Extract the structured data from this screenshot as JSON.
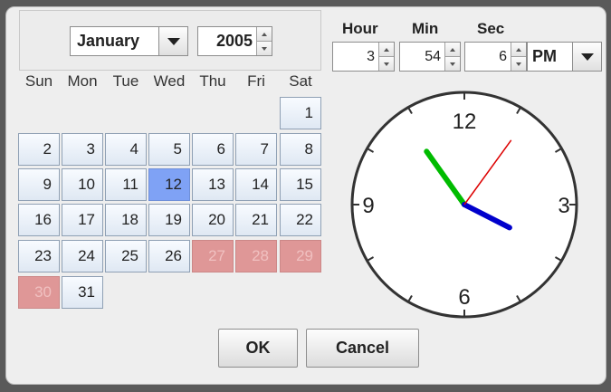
{
  "date": {
    "month": "January",
    "year": "2005",
    "weekdays": [
      "Sun",
      "Mon",
      "Tue",
      "Wed",
      "Thu",
      "Fri",
      "Sat"
    ],
    "selected_day": "12",
    "days": [
      "1",
      "2",
      "3",
      "4",
      "5",
      "6",
      "7",
      "8",
      "9",
      "10",
      "11",
      "12",
      "13",
      "14",
      "15",
      "16",
      "17",
      "18",
      "19",
      "20",
      "21",
      "22",
      "23",
      "24",
      "25",
      "26",
      "27",
      "28",
      "29",
      "30",
      "31"
    ]
  },
  "time": {
    "hour_label": "Hour",
    "min_label": "Min",
    "sec_label": "Sec",
    "hour": "3",
    "minute": "54",
    "second": "6",
    "ampm": "PM"
  },
  "clock": {
    "labels": [
      "12",
      "3",
      "6",
      "9"
    ],
    "hour_hand_color": "#0000cc",
    "minute_hand_color": "#00bb00",
    "second_hand_color": "#dd0000"
  },
  "buttons": {
    "ok": "OK",
    "cancel": "Cancel"
  }
}
